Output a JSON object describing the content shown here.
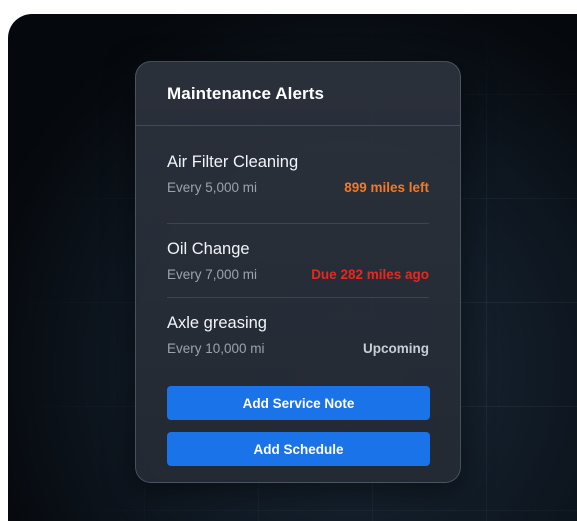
{
  "card": {
    "title": "Maintenance Alerts"
  },
  "alerts": [
    {
      "name": "Air Filter Cleaning",
      "interval": "Every 5,000 mi",
      "status": "899 miles left",
      "status_color": "#f07a2a"
    },
    {
      "name": "Oil Change",
      "interval": "Every 7,000 mi",
      "status": "Due 282 miles ago",
      "status_color": "#e8281e"
    },
    {
      "name": "Axle greasing",
      "interval": "Every 10,000 mi",
      "status": "Upcoming",
      "status_color": "#c9ced4"
    }
  ],
  "actions": {
    "add_note_label": "Add Service Note",
    "add_schedule_label": "Add Schedule"
  },
  "colors": {
    "accent": "#1a73e8",
    "background": "#0f1822",
    "card": "#2a3039"
  }
}
